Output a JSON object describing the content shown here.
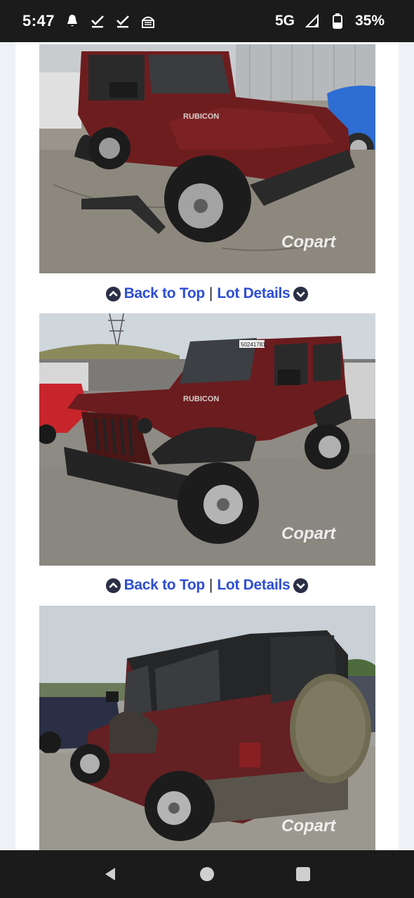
{
  "status_bar": {
    "time": "5:47",
    "network": "5G",
    "battery": "35%",
    "icons": [
      "notification-icon",
      "check-icon",
      "check-icon",
      "sim-icon",
      "signal-icon",
      "battery-icon"
    ]
  },
  "nav_links": {
    "back_to_top": "Back to Top",
    "separator": "|",
    "lot_details": "Lot Details"
  },
  "photos": [
    {
      "watermark": "Copart"
    },
    {
      "watermark": "Copart",
      "windshield_tag": "50241781"
    },
    {
      "watermark": "Copart"
    }
  ],
  "vehicle_badge": "RUBICON",
  "colors": {
    "link": "#2d4ed4",
    "icon_fill": "#2a2f45",
    "status_bar": "#1b1b1b"
  },
  "system_nav": [
    "back-icon",
    "home-icon",
    "recents-icon"
  ]
}
